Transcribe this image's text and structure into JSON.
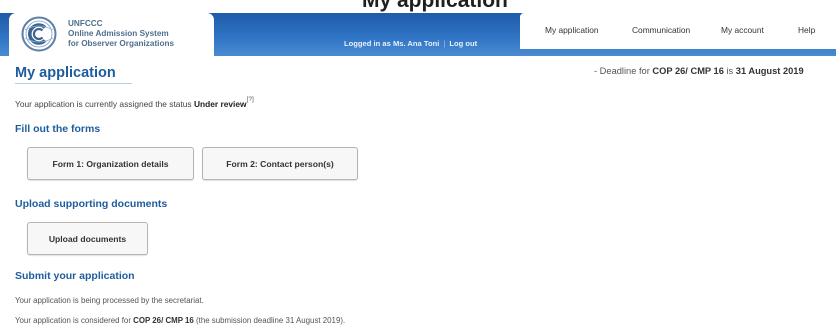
{
  "page": {
    "top_heading_fragment": "My application"
  },
  "header": {
    "logo": {
      "line1": "UNFCCC",
      "line2": "Online Admission System",
      "line3": "for Observer Organizations"
    },
    "login": {
      "text": "Logged in as Ms. Ana Toni",
      "separator": "|",
      "logout": "Log out"
    },
    "nav": [
      {
        "label": "My application"
      },
      {
        "label": "Communication"
      },
      {
        "label": "My account"
      },
      {
        "label": "Help"
      }
    ]
  },
  "main": {
    "title": "My application",
    "deadline": {
      "prefix": "- Deadline for ",
      "session": "COP 26/ CMP 16",
      "middle": " is ",
      "date": "31 August 2019"
    },
    "status": {
      "prefix": "Your application is currently assigned the status ",
      "value": "Under review",
      "help_ref": "[?]"
    },
    "forms": {
      "title": "Fill out the forms",
      "buttons": [
        "Form 1: Organization details",
        "Form 2: Contact person(s)"
      ]
    },
    "upload": {
      "title": "Upload supporting documents",
      "button": "Upload documents"
    },
    "submit": {
      "title": "Submit your application",
      "line1": "Your application is being processed by the secretariat.",
      "line2_prefix": "Your application is considered for ",
      "line2_session": "COP 26/ CMP 16",
      "line2_suffix": " (the submission deadline 31 August 2019)."
    }
  },
  "colors": {
    "header_blue": "#2f74c4",
    "heading_blue": "#1d5c9e",
    "button_bg": "#f7f7f7"
  },
  "icons": {
    "logo": "unfccc-logo-icon"
  }
}
